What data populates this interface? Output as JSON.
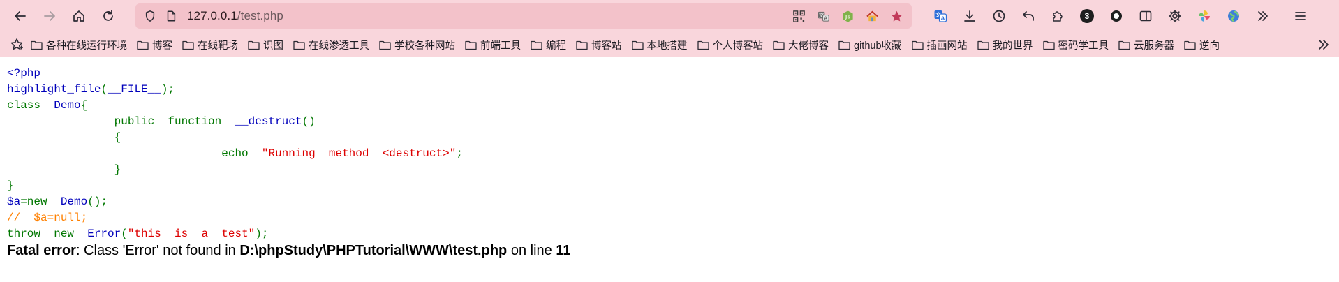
{
  "browser": {
    "url_host": "127.0.0.1",
    "url_path": "/test.php",
    "extension_badge": "3",
    "colors": {
      "toolbar_bg": "#f9d6dc",
      "urlbar_bg": "#f3c2ca",
      "star": "#c23a5a"
    }
  },
  "bookmarks": {
    "items": [
      "各种在线运行环境",
      "博客",
      "在线靶场",
      "识图",
      "在线渗透工具",
      "学校各种网站",
      "前端工具",
      "编程",
      "博客站",
      "本地搭建",
      "个人博客站",
      "大佬博客",
      "github收藏",
      "插画网站",
      "我的世界",
      "密码学工具",
      "云服务器",
      "逆向"
    ]
  },
  "code": {
    "lines": [
      [
        {
          "t": "<?php",
          "c": "default"
        }
      ],
      [
        {
          "t": "highlight_file",
          "c": "default"
        },
        {
          "t": "(",
          "c": "keyword"
        },
        {
          "t": "__FILE__",
          "c": "default"
        },
        {
          "t": ");",
          "c": "keyword"
        }
      ],
      [
        {
          "t": "class  ",
          "c": "keyword"
        },
        {
          "t": "Demo",
          "c": "default"
        },
        {
          "t": "{",
          "c": "keyword"
        }
      ],
      [
        {
          "t": "                ",
          "c": "keyword"
        },
        {
          "t": "public  function  ",
          "c": "keyword"
        },
        {
          "t": "__destruct",
          "c": "default"
        },
        {
          "t": "()",
          "c": "keyword"
        }
      ],
      [
        {
          "t": "                {",
          "c": "keyword"
        }
      ],
      [
        {
          "t": "                                ",
          "c": "keyword"
        },
        {
          "t": "echo  ",
          "c": "keyword"
        },
        {
          "t": "\"Running  method  <destruct>\"",
          "c": "string"
        },
        {
          "t": ";",
          "c": "keyword"
        }
      ],
      [
        {
          "t": "                }",
          "c": "keyword"
        }
      ],
      [
        {
          "t": "}",
          "c": "keyword"
        }
      ],
      [
        {
          "t": "$a",
          "c": "default"
        },
        {
          "t": "=new  ",
          "c": "keyword"
        },
        {
          "t": "Demo",
          "c": "default"
        },
        {
          "t": "();",
          "c": "keyword"
        }
      ],
      [
        {
          "t": "//  $a=null;",
          "c": "comment"
        }
      ],
      [
        {
          "t": "throw  new  ",
          "c": "keyword"
        },
        {
          "t": "Error",
          "c": "default"
        },
        {
          "t": "(",
          "c": "keyword"
        },
        {
          "t": "\"this  is  a  test\"",
          "c": "string"
        },
        {
          "t": ");",
          "c": "keyword"
        }
      ]
    ]
  },
  "error": {
    "label": "Fatal error",
    "message": ": Class 'Error' not found in ",
    "file": "D:\\phpStudy\\PHPTutorial\\WWW\\test.php",
    "on_line_text": " on line ",
    "line": "11"
  }
}
